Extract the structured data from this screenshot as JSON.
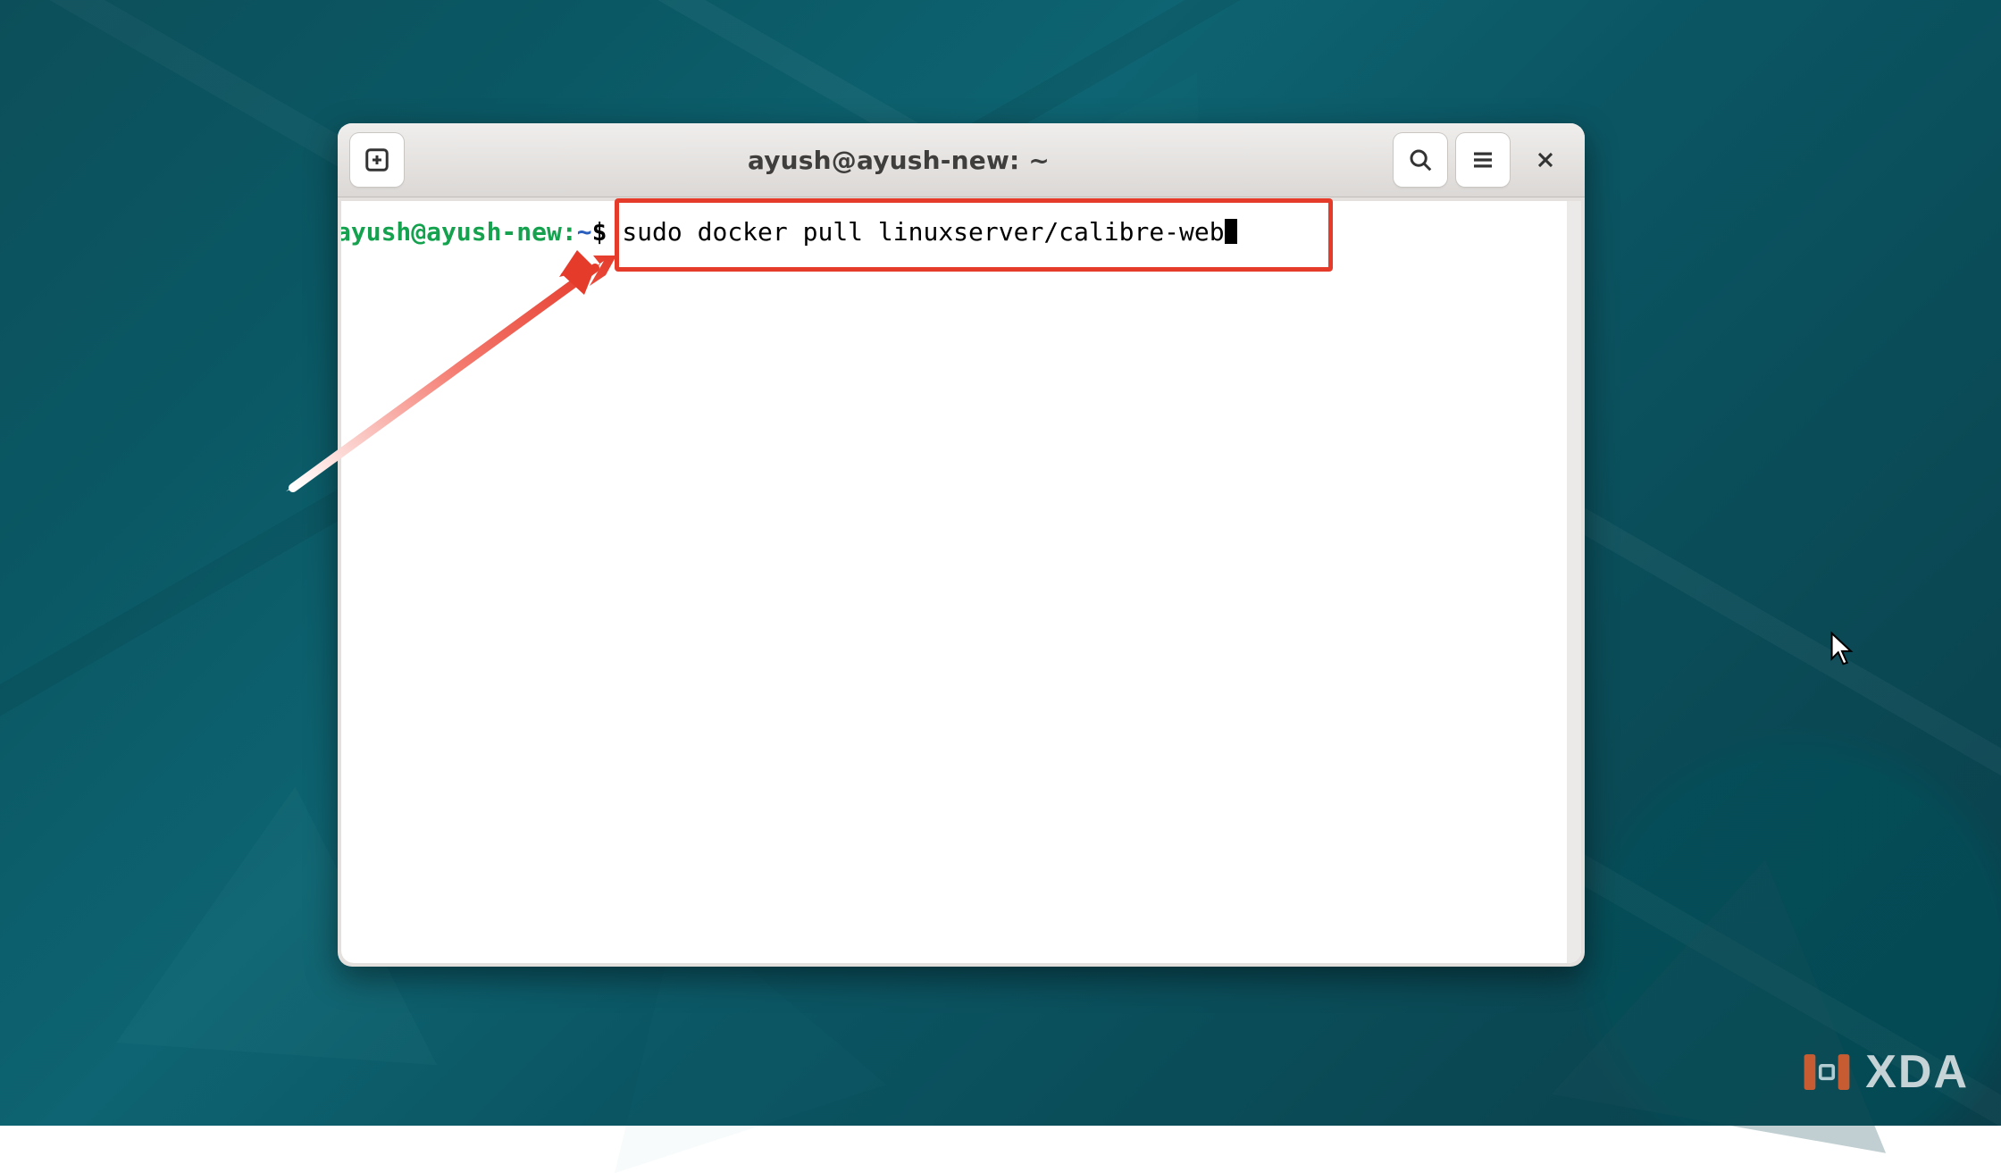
{
  "window": {
    "title": "ayush@ayush-new: ~"
  },
  "terminal": {
    "prompt_user_host": "ayush@ayush-new",
    "prompt_path": "~",
    "prompt_symbol": "$",
    "command": "sudo docker pull linuxserver/calibre-web"
  },
  "annotation": {
    "highlight_color": "#e53b2b"
  },
  "watermark": {
    "text": "XDA"
  }
}
